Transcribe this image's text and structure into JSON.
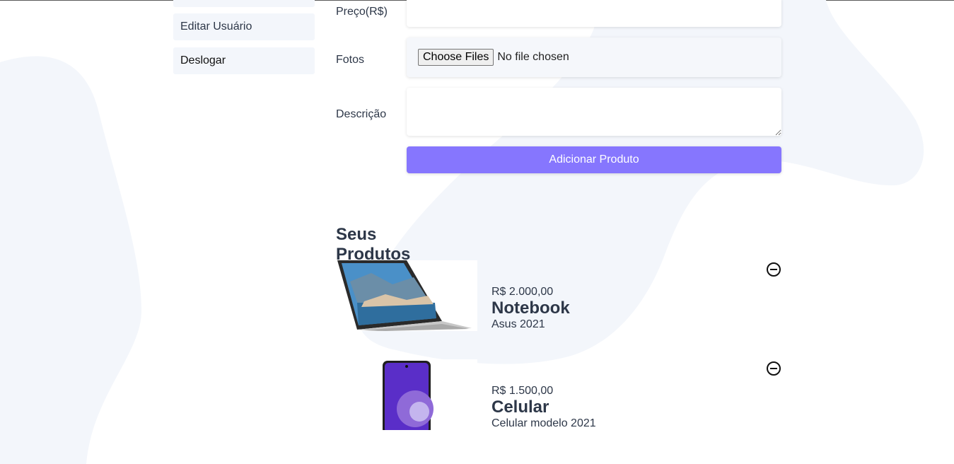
{
  "sidebar": {
    "items": [
      {
        "label": ""
      },
      {
        "label": "Editar Usuário"
      },
      {
        "label": "Deslogar"
      }
    ]
  },
  "form": {
    "price_label": "Preço(R$)",
    "price_value": "",
    "photos_label": "Fotos",
    "file_button": "Choose Files",
    "file_status": "No file chosen",
    "description_label": "Descrição",
    "description_value": "",
    "submit_label": "Adicionar Produto"
  },
  "products_section": {
    "title": "Seus Produtos",
    "items": [
      {
        "price": "R$ 2.000,00",
        "name": "Notebook",
        "description": "Asus 2021",
        "image": "laptop"
      },
      {
        "price": "R$ 1.500,00",
        "name": "Celular",
        "description": "Celular modelo 2021",
        "image": "phone"
      }
    ]
  },
  "colors": {
    "accent": "#8676fe",
    "background_blob": "#f3f6fb",
    "text": "#2d3748",
    "sidebar_item_bg": "#f3f6fb"
  },
  "icons": {
    "remove": "remove-circle-icon",
    "laptop": "laptop-image",
    "phone": "phone-image"
  }
}
